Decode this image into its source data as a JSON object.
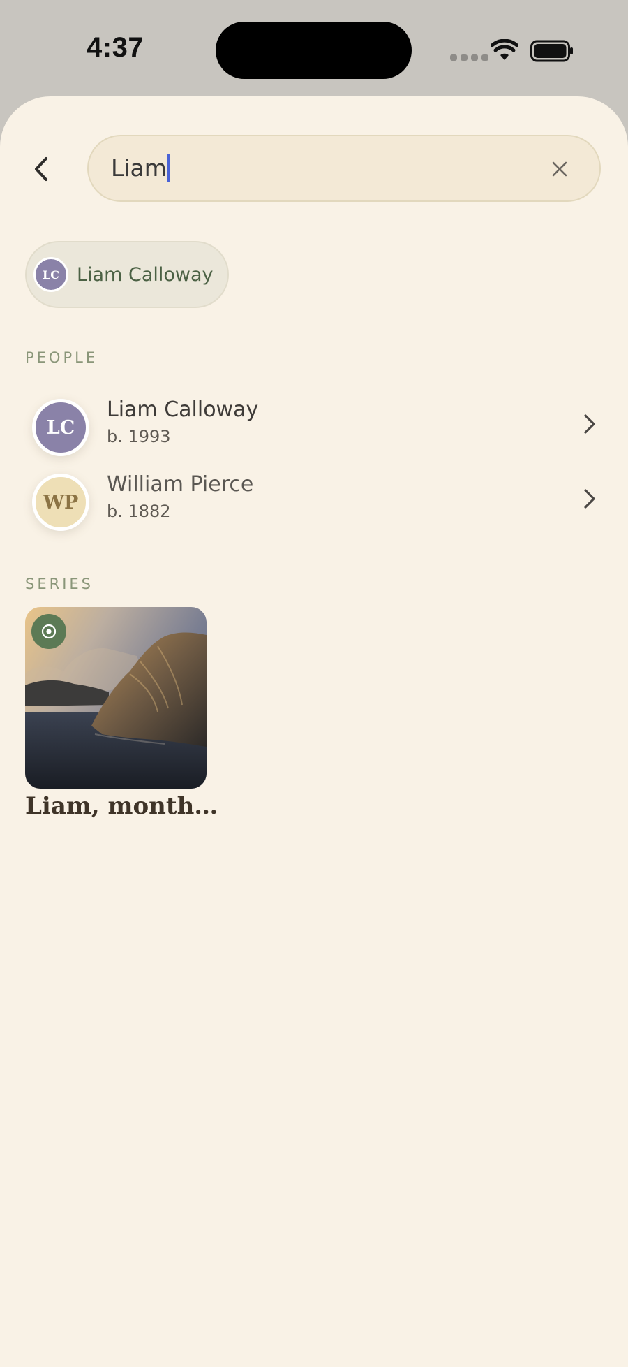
{
  "status_bar": {
    "time": "4:37",
    "icons": [
      "cellular-signal-icon",
      "wifi-icon",
      "battery-icon"
    ]
  },
  "header": {
    "back_icon": "chevron-left-icon",
    "search": {
      "value": "Liam",
      "clear_icon": "close-icon"
    }
  },
  "selected_chip": {
    "initials": "LC",
    "label": "Liam Calloway",
    "color": "#8a82a8"
  },
  "people": {
    "section_label": "PEOPLE",
    "items": [
      {
        "initials": "LC",
        "name": "Liam Calloway",
        "sub": "b. 1993",
        "avatar_color": "#8a82a8"
      },
      {
        "initials": "WP",
        "name": "William Pierce",
        "sub": "b. 1882",
        "avatar_color": "#eedfb6"
      }
    ]
  },
  "series": {
    "section_label": "SERIES",
    "items": [
      {
        "title": "Liam, month…",
        "badge_icon": "target-icon",
        "image": "coastal-cliff-sunset-photo"
      }
    ]
  },
  "colors": {
    "background": "#f9f2e6",
    "accent_green": "#5c7a55",
    "caret": "#4a63d6"
  }
}
